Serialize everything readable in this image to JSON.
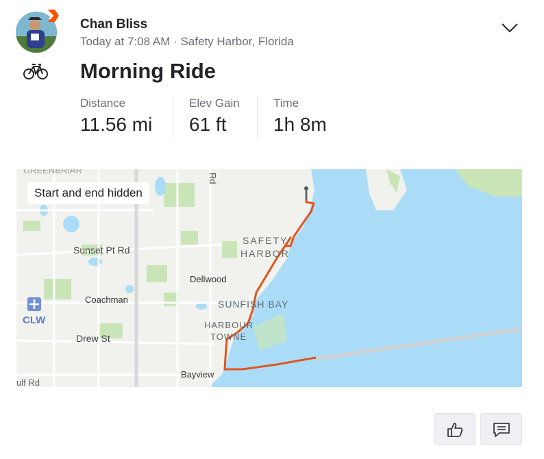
{
  "athlete": {
    "name": "Chan Bliss",
    "meta": "Today at 7:08 AM · Safety Harbor, Florida"
  },
  "activity": {
    "title": "Morning Ride",
    "icon": "bike-icon",
    "stats": [
      {
        "label": "Distance",
        "value": "11.56 mi"
      },
      {
        "label": "Elev Gain",
        "value": "61 ft"
      },
      {
        "label": "Time",
        "value": "1h 8m"
      }
    ]
  },
  "map": {
    "privacy_chip": "Start and end hidden",
    "labels": {
      "safety": "SAFETY",
      "harbor": "HARBOR",
      "sunset": "Sunset Pt Rd",
      "dellwood": "Dellwood",
      "coachman": "Coachman",
      "clw": "CLW",
      "drew": "Drew St",
      "sunfish": "SUNFISH BAY",
      "harbour_towne_1": "HARBOUR",
      "harbour_towne_2": "TOWNE",
      "bayview": "Bayview",
      "rd_vertical": "Rd",
      "gulf_rd": "ulf Rd",
      "greenbriar": "GREENBRIAR"
    },
    "colors": {
      "water": "#aadcf8",
      "land": "#f1f1ee",
      "park": "#c9e5b8",
      "route": "#e0541f"
    }
  },
  "actions": {
    "kudos_icon": "thumbs-up-icon",
    "comment_icon": "comment-icon"
  }
}
